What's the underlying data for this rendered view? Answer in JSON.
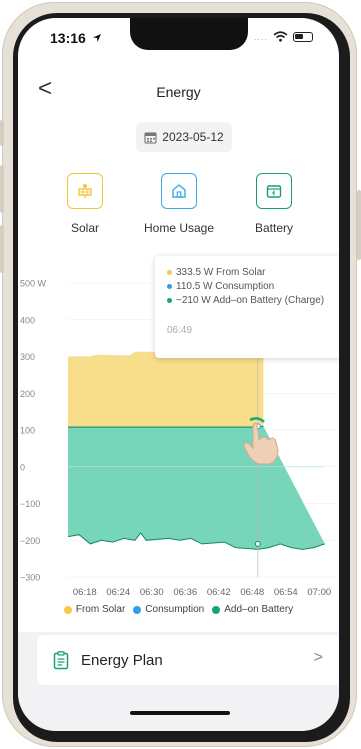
{
  "status_bar": {
    "time": "13:16"
  },
  "nav": {
    "title": "Energy",
    "back_glyph": "<"
  },
  "date_picker": {
    "value": "2023-05-12"
  },
  "tabs": [
    {
      "label": "Solar",
      "icon": "solar-panel-icon",
      "color": "#f2c53d"
    },
    {
      "label": "Home Usage",
      "icon": "home-icon",
      "color": "#3aa9e6"
    },
    {
      "label": "Battery",
      "icon": "battery-icon",
      "color": "#17a06f"
    }
  ],
  "tooltip": {
    "rows": [
      {
        "text": "333.5 W From Solar",
        "color": "#f7c948"
      },
      {
        "text": "110.5 W Consumption",
        "color": "#2e9fe8"
      },
      {
        "text": "−210 W Add–on Battery (Charge)",
        "color": "#16a37a"
      }
    ],
    "time": "06:49"
  },
  "chart_data": {
    "type": "area",
    "x_ticks": [
      "06:18",
      "06:24",
      "06:30",
      "06:36",
      "06:42",
      "06:48",
      "06:54",
      "07:00"
    ],
    "y_ticks": [
      "500 W",
      "400",
      "300",
      "200",
      "100",
      "0",
      "−100",
      "−200",
      "−300"
    ],
    "ylim": [
      -300,
      500
    ],
    "xlim": [
      "06:15",
      "07:03"
    ],
    "cursor_x": "06:49",
    "series": [
      {
        "name": "From Solar",
        "color": "#f7d775",
        "values": [
          [
            0,
            300
          ],
          [
            4,
            300
          ],
          [
            5,
            305
          ],
          [
            11,
            303
          ],
          [
            12,
            313
          ],
          [
            20,
            313
          ],
          [
            21,
            300
          ],
          [
            28,
            300
          ],
          [
            29,
            305
          ],
          [
            34,
            304
          ],
          [
            35,
            333
          ]
        ]
      },
      {
        "name": "Consumption",
        "color": "#2e9fe8",
        "values": [
          [
            0,
            108
          ],
          [
            34,
            108
          ],
          [
            35,
            110
          ]
        ]
      },
      {
        "name": "Add–on Battery",
        "color": "#5fcfae",
        "values": [
          [
            0,
            -190
          ],
          [
            2,
            -185
          ],
          [
            4,
            -210
          ],
          [
            6,
            -200
          ],
          [
            8,
            -205
          ],
          [
            10,
            -195
          ],
          [
            12,
            -200
          ],
          [
            13,
            -180
          ],
          [
            14,
            -200
          ],
          [
            18,
            -195
          ],
          [
            20,
            -200
          ],
          [
            22,
            -195
          ],
          [
            24,
            -210
          ],
          [
            28,
            -205
          ],
          [
            30,
            -220
          ],
          [
            34,
            -225
          ],
          [
            36,
            -220
          ],
          [
            38,
            -210
          ],
          [
            40,
            -220
          ],
          [
            42,
            -225
          ],
          [
            44,
            -220
          ],
          [
            46,
            -210
          ]
        ]
      }
    ]
  },
  "legend": [
    {
      "label": "From Solar",
      "color": "#f7c948"
    },
    {
      "label": "Consumption",
      "color": "#2e9fe8"
    },
    {
      "label": "Add–on Battery",
      "color": "#16a37a"
    }
  ],
  "plan_card": {
    "label": "Energy Plan",
    "chevron": ">"
  }
}
